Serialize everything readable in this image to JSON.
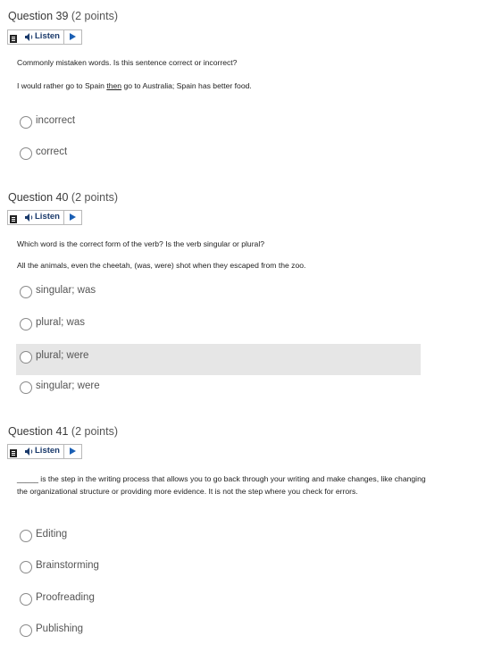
{
  "questions": [
    {
      "number_label": "Question 39",
      "points_label": "(2 points)",
      "listen_label": "Listen",
      "prompt_lines": [
        "Commonly mistaken words. Is this sentence correct or incorrect?"
      ],
      "sentence": {
        "before": "I would rather go to Spain ",
        "underlined": "then",
        "after": " go to Australia; Spain has better food."
      },
      "options": [
        "incorrect",
        "correct"
      ]
    },
    {
      "number_label": "Question 40",
      "points_label": "(2 points)",
      "listen_label": "Listen",
      "prompt_lines": [
        "Which word is the correct form of the verb? Is the verb singular or plural?",
        "All the animals, even the cheetah, (was, were) shot when they escaped from the zoo."
      ],
      "options": [
        "singular; was",
        "plural; was",
        "plural; were",
        "singular; were"
      ],
      "highlighted_option": "plural; were"
    },
    {
      "number_label": "Question 41",
      "points_label": "(2 points)",
      "listen_label": "Listen",
      "prompt_paragraph": "_____ is the step in the writing process that allows you to go back through your writing and make changes, like changing the organizational structure or providing more evidence. It is not the step where you check for errors.",
      "options": [
        "Editing",
        "Brainstorming",
        "Proofreading",
        "Publishing"
      ]
    }
  ]
}
